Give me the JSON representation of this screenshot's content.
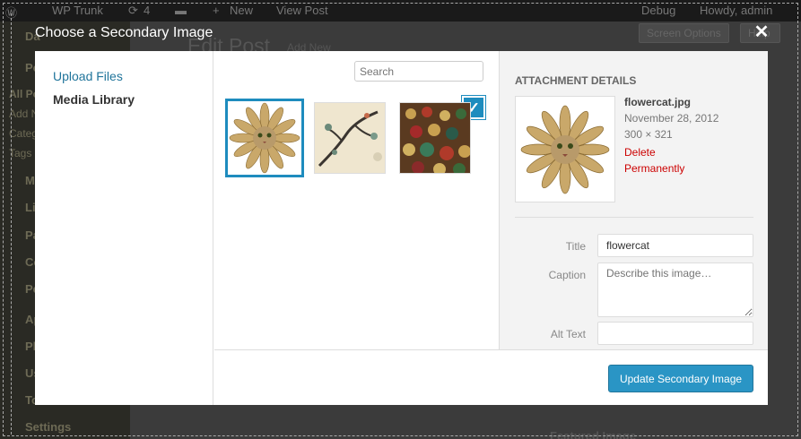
{
  "background": {
    "adminbar": {
      "site_name": "WP Trunk",
      "updates_count": "4",
      "new_label": "New",
      "view_post_label": "View Post",
      "debug_label": "Debug",
      "greeting": "Howdy, admin"
    },
    "page_title": "Edit Post",
    "add_new_label": "Add New",
    "screen_options_label": "Screen Options",
    "help_label": "Help",
    "sidebar_fragments": [
      "Da",
      "Po",
      "All Po",
      "Add N",
      "Categ",
      "Tags",
      "M",
      "Li",
      "Pa",
      "Co",
      "Pe",
      "Ap",
      "Pl",
      "Us",
      "To",
      "Settings"
    ],
    "featured_image_label": "Featured Image"
  },
  "modal": {
    "title": "Choose a Secondary Image",
    "close_icon": "close-icon",
    "menu": {
      "upload_files": "Upload Files",
      "media_library": "Media Library"
    },
    "search": {
      "placeholder": "Search"
    },
    "attachments": [
      {
        "name": "flowercat",
        "selected": true
      },
      {
        "name": "branch",
        "selected": false
      },
      {
        "name": "game-pieces",
        "selected": false
      }
    ],
    "details": {
      "heading": "Attachment Details",
      "filename": "flowercat.jpg",
      "date": "November 28, 2012",
      "dimensions": "300 × 321",
      "delete_label": "Delete Permanently",
      "title_label": "Title",
      "title_value": "flowercat",
      "caption_label": "Caption",
      "caption_placeholder": "Describe this image…",
      "alt_label": "Alt Text",
      "alt_value": ""
    },
    "update_button": "Update Secondary Image"
  },
  "colors": {
    "accent": "#1e8cbe",
    "button": "#2a95c5",
    "delete": "#cc0000"
  }
}
